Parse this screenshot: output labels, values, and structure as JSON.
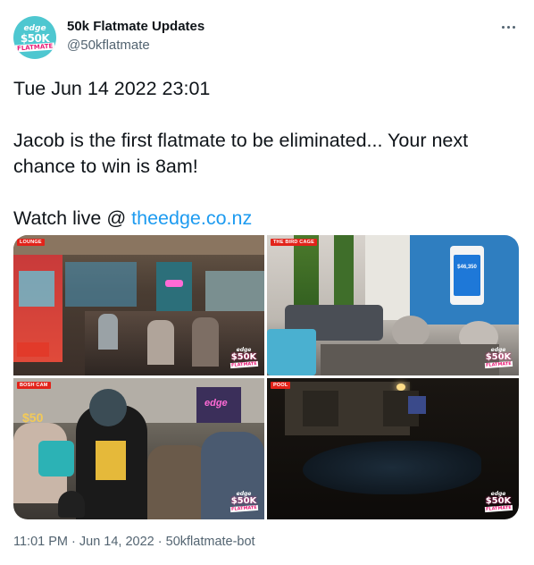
{
  "account": {
    "display_name": "50k Flatmate Updates",
    "handle": "@50kflatmate",
    "avatar": {
      "line1": "edge",
      "line2": "$50K",
      "line3": "FLATMATE"
    }
  },
  "more_icon": "more-horizontal-icon",
  "tweet": {
    "line1": "Tue Jun 14 2022 23:01",
    "line2": "Jacob is the first flatmate to be eliminated... Your next",
    "line3": "chance to win is 8am!",
    "line4_prefix": "Watch live @ ",
    "link": "theedge.co.nz"
  },
  "media": {
    "tiles": [
      {
        "label": "LOUNGE",
        "phone_amount": ""
      },
      {
        "label": "THE BIRD CAGE",
        "phone_amount": "$46,350"
      },
      {
        "label": "BOSH CAM",
        "phone_amount": ""
      },
      {
        "label": "POOL",
        "phone_amount": ""
      }
    ],
    "watermark": {
      "line1": "edge",
      "line2": "$50K",
      "line3": "FLATMATE"
    },
    "sign_text": "edge",
    "overlay_text": "$50"
  },
  "meta": {
    "time": "11:01 PM",
    "separator": " · ",
    "date": "Jun 14, 2022",
    "source": "50kflatmate-bot"
  },
  "colors": {
    "text": "#0f1419",
    "secondary": "#536471",
    "link": "#1d9bf0",
    "avatar_bg": "#4ec7d0",
    "brand_pink": "#e91e78",
    "cam_label": "#e2231a"
  }
}
